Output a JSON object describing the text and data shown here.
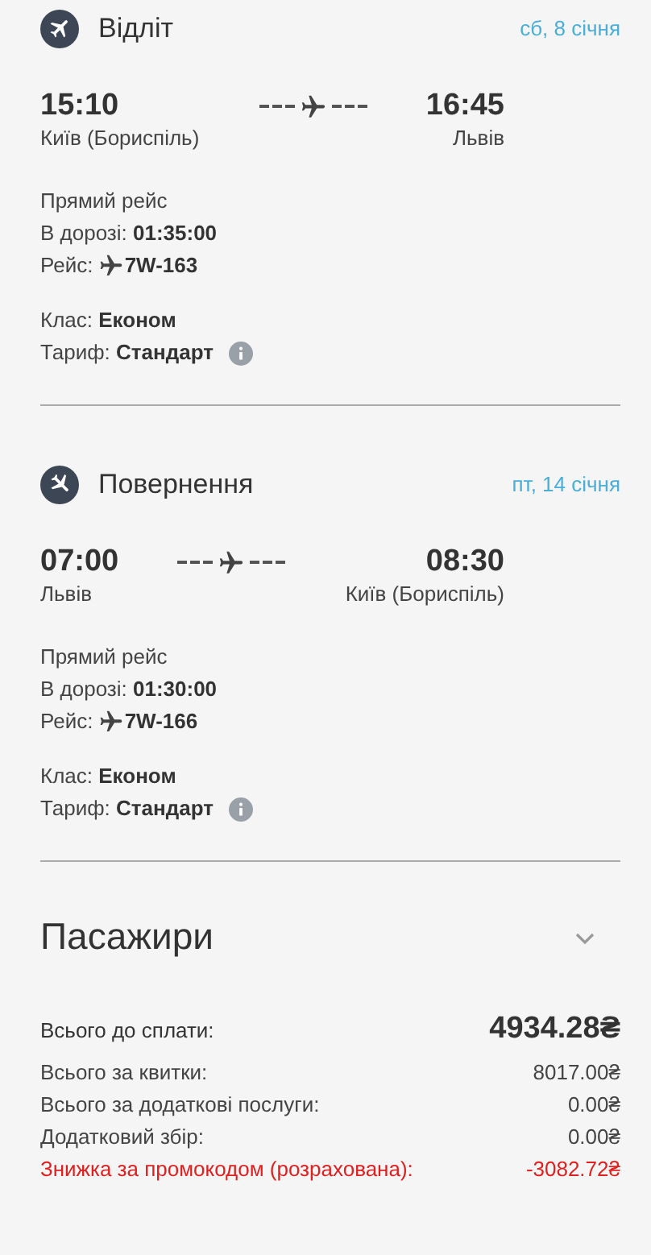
{
  "flights": [
    {
      "kind": "departure",
      "title": "Відліт",
      "date": "сб, 8 січня",
      "departure": {
        "time": "15:10",
        "city": "Київ (Бориспіль)"
      },
      "arrival": {
        "time": "16:45",
        "city": "Львів"
      },
      "route_type": "Прямий рейс",
      "duration": "В дорозі: **01:35:00**",
      "flight_label": "Рейс:",
      "flight_number": "7W-163",
      "class": "Клас: **Економ**",
      "tariff": "Тариф: **Стандарт**"
    },
    {
      "kind": "return",
      "title": "Повернення",
      "date": "пт, 14 січня",
      "departure": {
        "time": "07:00",
        "city": "Львів"
      },
      "arrival": {
        "time": "08:30",
        "city": "Київ (Бориспіль)"
      },
      "route_type": "Прямий рейс",
      "duration": "В дорозі: **01:30:00**",
      "flight_label": "Рейс:",
      "flight_number": "7W-166",
      "class": "Клас: **Економ**",
      "tariff": "Тариф: **Стандарт**"
    }
  ],
  "passengers": {
    "title": "Пасажири",
    "expanded": false
  },
  "summary": [
    {
      "kind": "total",
      "label": "Всього до сплати:",
      "value": "4934.28₴"
    },
    {
      "kind": "line",
      "label": "Всього за квитки:",
      "value": "8017.00₴"
    },
    {
      "kind": "line",
      "label": "Всього за додаткові послуги:",
      "value": "0.00₴"
    },
    {
      "kind": "line",
      "label": "Додатковий збір:",
      "value": "0.00₴"
    },
    {
      "kind": "discount",
      "label": "Знижка за промокодом (розрахована):",
      "value": "-3082.72₴"
    }
  ]
}
